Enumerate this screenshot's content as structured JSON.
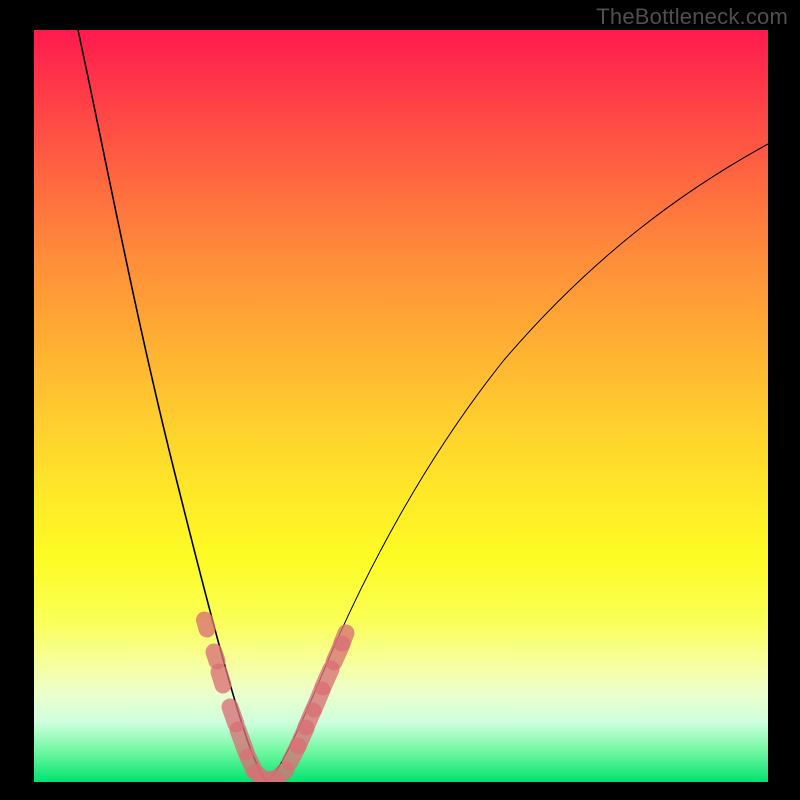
{
  "watermark": "TheBottleneck.com",
  "chart_data": {
    "type": "line",
    "title": "",
    "xlabel": "",
    "ylabel": "",
    "xlim": [
      0,
      1
    ],
    "ylim": [
      0,
      1
    ],
    "background_gradient": {
      "top_color": "#ff1a4e",
      "bottom_color": "#00e36e",
      "description": "Vertical red→orange→yellow→green gradient behind curve"
    },
    "series": [
      {
        "name": "bottleneck-curve-left",
        "description": "Left descending branch of V-shaped curve (higher % → lower x until minimum)",
        "x": [
          0.06,
          0.1,
          0.14,
          0.18,
          0.22,
          0.25,
          0.28,
          0.295,
          0.31
        ],
        "y": [
          1.0,
          0.78,
          0.58,
          0.4,
          0.24,
          0.12,
          0.04,
          0.01,
          0.0
        ]
      },
      {
        "name": "bottleneck-curve-right",
        "description": "Right ascending branch of V-shaped curve (values rise with x past minimum)",
        "x": [
          0.31,
          0.34,
          0.38,
          0.44,
          0.52,
          0.62,
          0.74,
          0.88,
          1.0
        ],
        "y": [
          0.0,
          0.06,
          0.16,
          0.3,
          0.45,
          0.58,
          0.7,
          0.79,
          0.85
        ]
      }
    ],
    "markers": {
      "description": "Pink rounded markers highlighting points near the minimum of the curve",
      "points": [
        {
          "x": 0.231,
          "y": 0.214
        },
        {
          "x": 0.244,
          "y": 0.172
        },
        {
          "x": 0.251,
          "y": 0.146
        },
        {
          "x": 0.266,
          "y": 0.1
        },
        {
          "x": 0.276,
          "y": 0.067
        },
        {
          "x": 0.285,
          "y": 0.037
        },
        {
          "x": 0.294,
          "y": 0.015
        },
        {
          "x": 0.303,
          "y": 0.005
        },
        {
          "x": 0.312,
          "y": 0.0
        },
        {
          "x": 0.321,
          "y": 0.003
        },
        {
          "x": 0.33,
          "y": 0.015
        },
        {
          "x": 0.348,
          "y": 0.05
        },
        {
          "x": 0.358,
          "y": 0.078
        },
        {
          "x": 0.368,
          "y": 0.105
        },
        {
          "x": 0.38,
          "y": 0.14
        },
        {
          "x": 0.392,
          "y": 0.175
        },
        {
          "x": 0.408,
          "y": 0.218
        },
        {
          "x": 0.419,
          "y": 0.248
        }
      ]
    },
    "minimum": {
      "x": 0.312,
      "y": 0.0
    }
  }
}
